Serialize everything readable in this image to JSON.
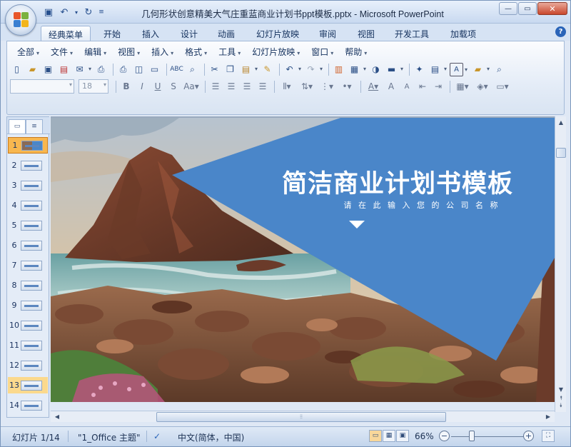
{
  "window": {
    "title": "几何形状创意精美大气庄重蓝商业计划书ppt模板.pptx - Microsoft PowerPoint"
  },
  "ribbon_tabs": [
    "经典菜单",
    "开始",
    "插入",
    "设计",
    "动画",
    "幻灯片放映",
    "审阅",
    "视图",
    "开发工具",
    "加载项"
  ],
  "menus": [
    "全部",
    "文件",
    "编辑",
    "视图",
    "插入",
    "格式",
    "工具",
    "幻灯片放映",
    "窗口",
    "帮助"
  ],
  "format": {
    "font_size": "18"
  },
  "slide_numbers": [
    "1",
    "2",
    "3",
    "4",
    "5",
    "6",
    "7",
    "8",
    "9",
    "10",
    "11",
    "12",
    "13",
    "14"
  ],
  "slide": {
    "title": "简洁商业计划书模板",
    "subtitle": "请 在 此 输 入 您 的 公 司 名 称",
    "accent": "#4a86c9"
  },
  "status": {
    "slide_count": "幻灯片 1/14",
    "theme": "\"1_Office 主题\"",
    "language": "中文(简体，中国)",
    "zoom": "66%"
  },
  "colors": {
    "ribbon_bg": "#dfe8f5",
    "selected_slide": "#f8b74f"
  }
}
